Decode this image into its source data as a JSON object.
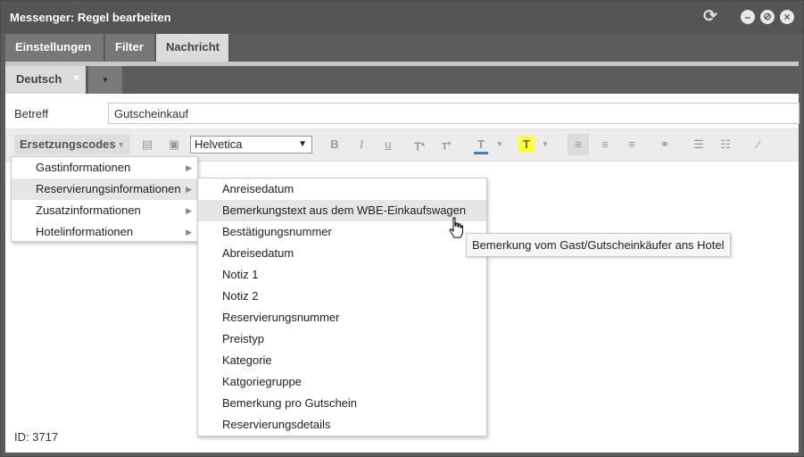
{
  "window": {
    "title": "Messenger: Regel bearbeiten",
    "icons": [
      "refresh-icon",
      "minimize-icon",
      "block-icon",
      "close-icon"
    ]
  },
  "tabs": [
    {
      "label": "Einstellungen",
      "active": false
    },
    {
      "label": "Filter",
      "active": false
    },
    {
      "label": "Nachricht",
      "active": true
    }
  ],
  "language_tab": {
    "label": "Deutsch",
    "close_glyph": "×",
    "dropdown_glyph": "▼"
  },
  "betreff": {
    "label": "Betreff",
    "value": "Gutscheinkauf"
  },
  "toolbar": {
    "ersetzungscodes_label": "Ersetzungscodes",
    "font": "Helvetica",
    "icons": [
      "table-icon",
      "image-icon",
      "bold-icon",
      "italic-icon",
      "underline-icon",
      "superscript-icon",
      "subscript-icon",
      "text-color-icon",
      "highlight-icon",
      "align-left-icon",
      "align-center-icon",
      "align-right-icon",
      "link-icon",
      "ordered-list-icon",
      "unordered-list-icon",
      "clear-format-icon"
    ],
    "accent_colors": {
      "text_color": "#3b7fc4",
      "highlight": "#ffff33"
    }
  },
  "menu_level1": [
    "Gastinformationen",
    "Reservierungsinformationen",
    "Zusatzinformationen",
    "Hotelinformationen"
  ],
  "menu_level1_hover_index": 1,
  "menu_level2": [
    "Anreisedatum",
    "Bemerkungstext aus dem WBE-Einkaufswagen",
    "Bestätigungsnummer",
    "Abreisedatum",
    "Notiz 1",
    "Notiz 2",
    "Reservierungsnummer",
    "Preistyp",
    "Kategorie",
    "Katgoriegruppe",
    "Bemerkung pro Gutschein",
    "Reservierungsdetails"
  ],
  "menu_level2_hover_index": 1,
  "tooltip": "Bemerkung vom Gast/Gutscheinkäufer ans Hotel",
  "status": "ID: 3717"
}
